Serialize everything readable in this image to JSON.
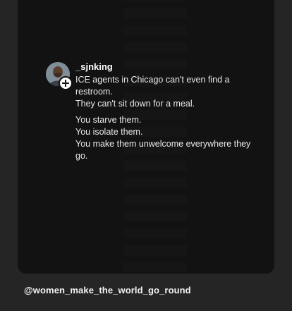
{
  "post": {
    "username": "_sjnking",
    "line1": "ICE agents in Chicago can't even find a restroom.",
    "line2": "They can't sit down for a meal.",
    "line3": "You starve them.",
    "line4": "You isolate them.",
    "line5": "You make them unwelcome everywhere they go."
  },
  "footer": {
    "handle": "@women_make_the_world_go_round"
  },
  "colors": {
    "background": "#252525",
    "card": "#121212",
    "text": "#e8e8e8"
  },
  "icons": {
    "avatar": "profile-photo",
    "follow": "plus-icon"
  }
}
